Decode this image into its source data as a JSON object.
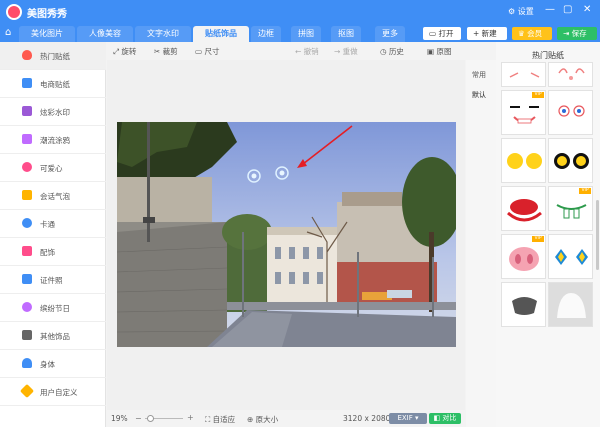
{
  "app": {
    "title": "美图秀秀",
    "settings_label": "设置",
    "min_icon": "minimize-icon",
    "max_icon": "maximize-icon",
    "close_icon": "close-icon"
  },
  "tabs": [
    "美化图片",
    "人像美容",
    "文字水印",
    "贴纸饰品",
    "边框",
    "拼图",
    "抠图",
    "更多"
  ],
  "active_tab": "贴纸饰品",
  "top_buttons": {
    "open": "打开",
    "new": "新建",
    "vip": "会员",
    "save": "保存"
  },
  "sidebar": {
    "items": [
      {
        "label": "热门贴纸",
        "icon": "flame-icon",
        "color": "#ff5a4f"
      },
      {
        "label": "电商贴纸",
        "icon": "cart-icon",
        "color": "#3f8ef5"
      },
      {
        "label": "炫彩水印",
        "icon": "rainbow-icon",
        "color": "#9b59d6"
      },
      {
        "label": "潮流涂鸦",
        "icon": "pen-icon",
        "color": "#c06bff"
      },
      {
        "label": "可爱心",
        "icon": "heart-icon",
        "color": "#ff4d8b"
      },
      {
        "label": "会话气泡",
        "icon": "speech-bubble-icon",
        "color": "#ffb400"
      },
      {
        "label": "卡通",
        "icon": "bear-icon",
        "color": "#3f8ef5"
      },
      {
        "label": "配饰",
        "icon": "bow-icon",
        "color": "#ff4d8b"
      },
      {
        "label": "证件照",
        "icon": "id-card-icon",
        "color": "#3f8ef5"
      },
      {
        "label": "缤纷节日",
        "icon": "balloon-icon",
        "color": "#c06bff"
      },
      {
        "label": "其他饰品",
        "icon": "grid-icon",
        "color": "#666666"
      },
      {
        "label": "身体",
        "icon": "person-icon",
        "color": "#3f8ef5"
      },
      {
        "label": "用户自定义",
        "icon": "link-icon",
        "color": "#ffb400"
      }
    ]
  },
  "toolbar": {
    "rotate": "旋转",
    "crop": "裁剪",
    "size": "尺寸",
    "undo": "撤销",
    "redo": "重做",
    "history": "历史",
    "original": "原图"
  },
  "status": {
    "zoom": "19%",
    "fit": "自适应",
    "actual_size": "原大小",
    "dimensions": "3120 x 2080",
    "exif": "EXIF",
    "compare": "对比"
  },
  "right_panel": {
    "title": "热门贴纸",
    "side_tabs": [
      "常用",
      "默认"
    ],
    "vip_tag": "VIP"
  },
  "colors": {
    "brand": "#3f8ef5",
    "save": "#2dbf66",
    "vip": "#ffc21a"
  }
}
